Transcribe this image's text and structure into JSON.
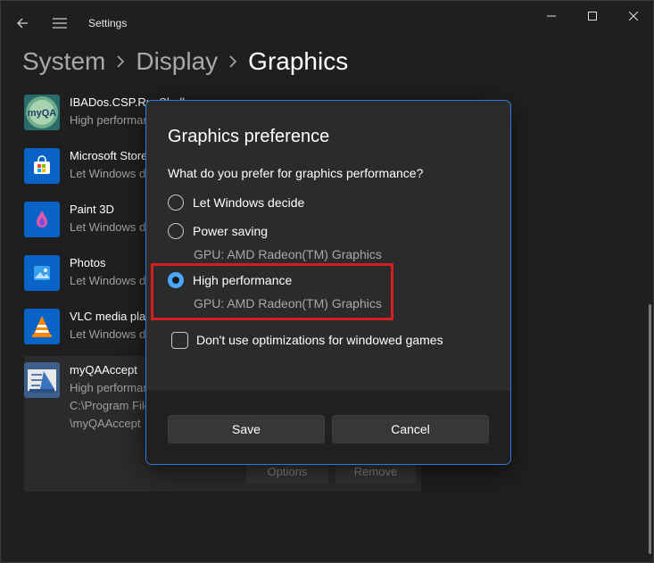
{
  "window": {
    "title": "Settings"
  },
  "breadcrumb": {
    "items": [
      "System",
      "Display",
      "Graphics"
    ],
    "separator": "›"
  },
  "apps": [
    {
      "name": "IBADos.CSP.RunShell",
      "pref": "High performance",
      "icon": "myqa-icon"
    },
    {
      "name": "Microsoft Store",
      "pref": "Let Windows decide",
      "icon": "microsoft-store-icon"
    },
    {
      "name": "Paint 3D",
      "pref": "Let Windows decide",
      "icon": "paint-3d-icon"
    },
    {
      "name": "Photos",
      "pref": "Let Windows decide",
      "icon": "photos-icon"
    },
    {
      "name": "VLC media player",
      "pref": "Let Windows decide",
      "icon": "vlc-icon"
    },
    {
      "name": "myQAAccept",
      "pref": "High performance",
      "icon": "myqaaccept-icon",
      "path_line1": "C:\\Program Files",
      "path_line2": "\\myQAAccept"
    }
  ],
  "app_buttons": {
    "options": "Options",
    "remove": "Remove"
  },
  "dialog": {
    "title": "Graphics preference",
    "question": "What do you prefer for graphics performance?",
    "options": [
      {
        "label": "Let Windows decide",
        "selected": false
      },
      {
        "label": "Power saving",
        "gpu": "GPU: AMD Radeon(TM) Graphics",
        "selected": false
      },
      {
        "label": "High performance",
        "gpu": "GPU: AMD Radeon(TM) Graphics",
        "selected": true
      }
    ],
    "checkbox_label": "Don't use optimizations for windowed games",
    "checkbox_checked": false,
    "save": "Save",
    "cancel": "Cancel"
  },
  "colors": {
    "accent": "#4ca7ff",
    "dialog_border": "#2f7bd6",
    "highlight": "#d42020"
  }
}
